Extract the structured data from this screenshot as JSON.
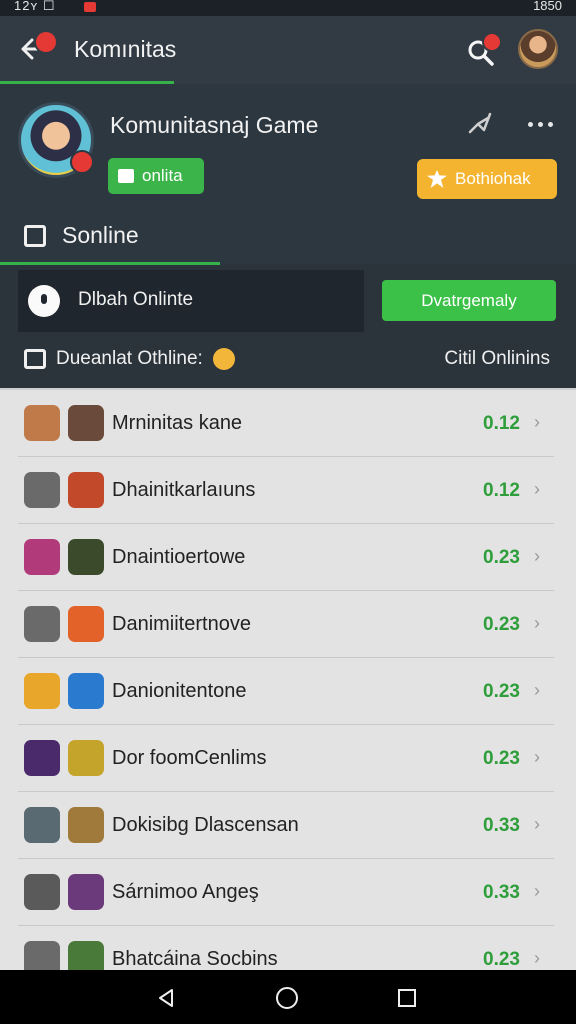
{
  "status_bar": {
    "left_text": "12ʏ ☐",
    "right_text": "1850"
  },
  "app_bar": {
    "title": "Komınitas",
    "back_icon": "arrow-left-icon",
    "search_icon": "search-icon"
  },
  "profile": {
    "name": "Komunitasnaj Game",
    "online_label": "onlita",
    "secondary_label": "Bothiohak",
    "section_title": "Sonline"
  },
  "status_card": {
    "label": "Dlbah Onlinte",
    "button_label": "Dvatrgemaly"
  },
  "filter_row": {
    "left_label": "Dueanlat Othline:",
    "right_label": "Citil Onlinins"
  },
  "colors": {
    "accent_green": "#35b34a",
    "accent_yellow": "#f4b430",
    "badge_red": "#e53935",
    "list_bg": "#e3e3e3"
  },
  "list": {
    "items": [
      {
        "name": "Mrninitas kane",
        "value": "0.12",
        "icon_a": "#c07a4a",
        "icon_b": "#6a4a3a"
      },
      {
        "name": "Dhainitkarlaıuns",
        "value": "0.12",
        "icon_a": "#6a6a6a",
        "icon_b": "#c24a2a"
      },
      {
        "name": "Dnaintioertowe",
        "value": "0.23",
        "icon_a": "#b03a7a",
        "icon_b": "#3a4a2a"
      },
      {
        "name": "Danimiitertnove",
        "value": "0.23",
        "icon_a": "#6a6a6a",
        "icon_b": "#e2622a"
      },
      {
        "name": "Danionitentone",
        "value": "0.23",
        "icon_a": "#e8a62a",
        "icon_b": "#2a7ad0"
      },
      {
        "name": "Dor foomCenlims",
        "value": "0.23",
        "icon_a": "#4a2a6a",
        "icon_b": "#c4a42a"
      },
      {
        "name": "Dokisibg Dlascensan",
        "value": "0.33",
        "icon_a": "#5a6a72",
        "icon_b": "#a07a3a"
      },
      {
        "name": "Sárnimoo Angeş",
        "value": "0.33",
        "icon_a": "#5a5a5a",
        "icon_b": "#6a3a7a"
      },
      {
        "name": "Bhatcáina  Socbins",
        "value": "0.23",
        "icon_a": "#6a6a6a",
        "icon_b": "#4a7a3a"
      }
    ]
  }
}
